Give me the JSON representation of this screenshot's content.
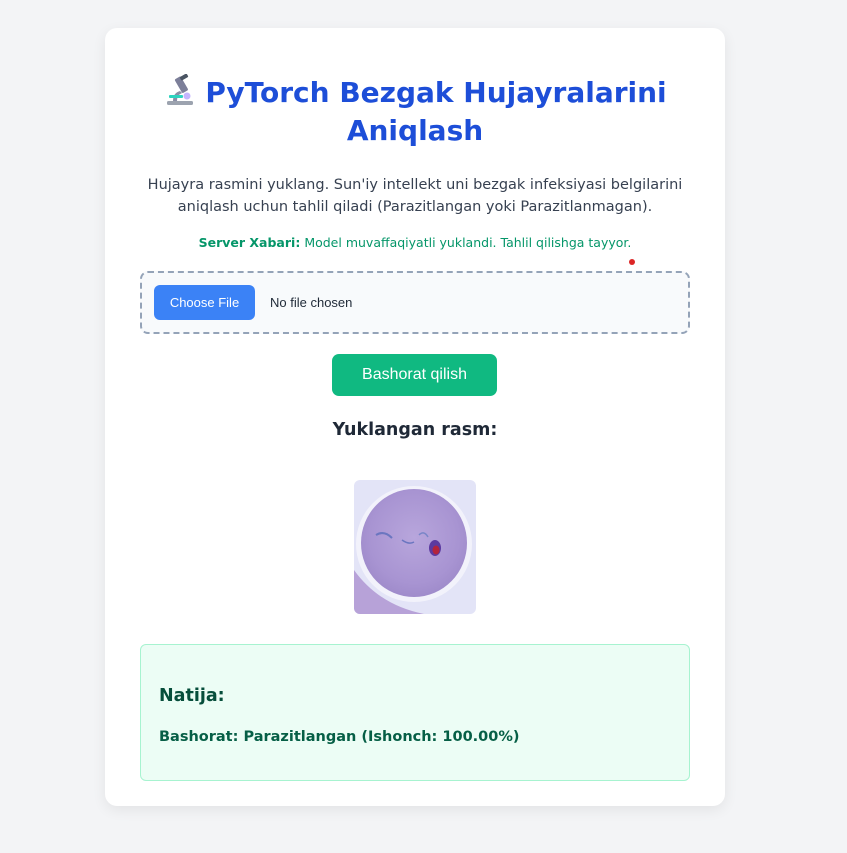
{
  "header": {
    "icon": "microscope-icon",
    "title_line1": "PyTorch Bezgak Hujayralarini",
    "title_line2": "Aniqlash"
  },
  "description": {
    "line1": "Hujayra rasmini yuklang. Sun'iy intellekt uni bezgak infeksiyasi belgilarini",
    "line2": "aniqlash uchun tahlil qiladi (Parazitlangan yoki Parazitlanmagan)."
  },
  "server_message": {
    "label": "Server Xabari:",
    "text": "Model muvaffaqiyatli yuklandi. Tahlil qilishga tayyor."
  },
  "file_input": {
    "button_label": "Choose File",
    "status": "No file chosen"
  },
  "predict_button": {
    "label": "Bashorat qilish"
  },
  "uploaded": {
    "heading": "Yuklangan rasm:"
  },
  "result": {
    "title": "Natija:",
    "line": "Bashorat: Parazitlangan (Ishonch: 100.00%)"
  },
  "colors": {
    "title": "#1d4ed8",
    "server_message": "#059669",
    "choose_button": "#3b82f6",
    "predict_button": "#10b981",
    "result_background": "#ecfdf5",
    "result_text": "#065f46"
  }
}
